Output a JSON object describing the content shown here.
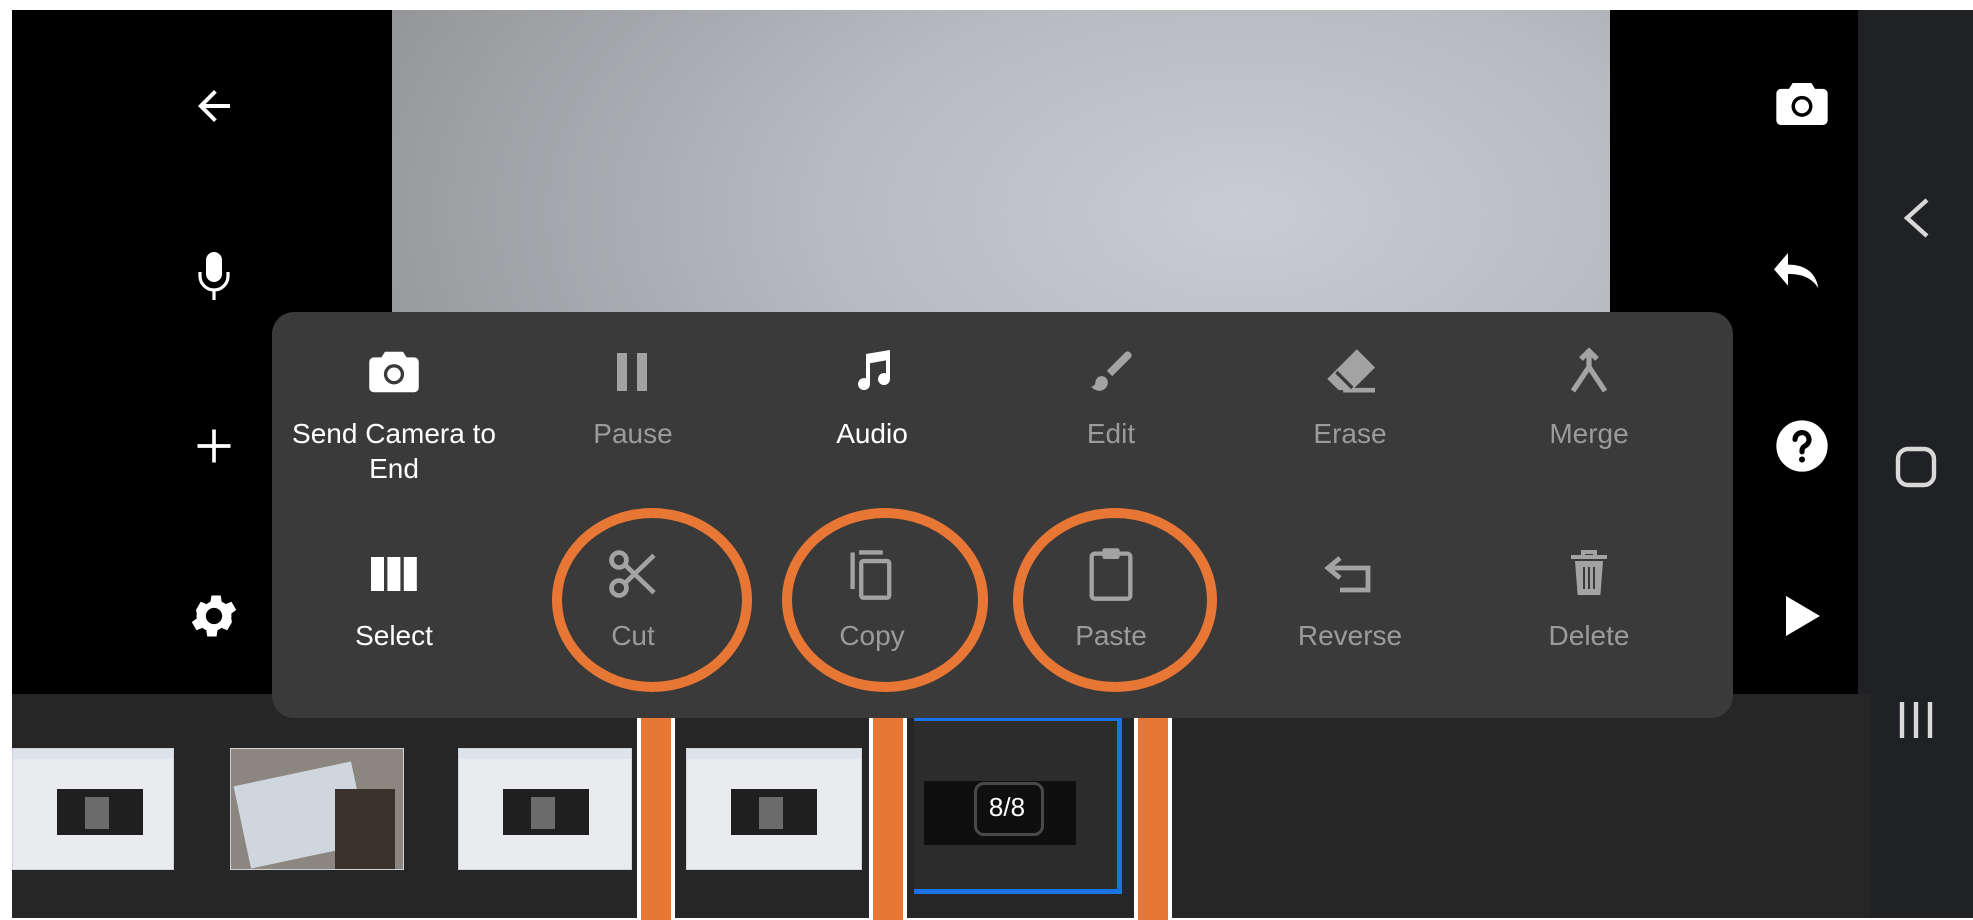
{
  "left_toolbar": {
    "back": "back-arrow-icon",
    "mic": "microphone-icon",
    "add": "plus-icon",
    "settings": "gear-icon"
  },
  "right_toolbar": {
    "camera": "camera-icon",
    "undo": "undo-icon",
    "help": "help-icon",
    "play": "play-icon"
  },
  "context_menu": {
    "row1": [
      {
        "label": "Send Camera to End",
        "icon": "camera-icon",
        "enabled": true
      },
      {
        "label": "Pause",
        "icon": "pause-icon",
        "enabled": false
      },
      {
        "label": "Audio",
        "icon": "music-note-icon",
        "enabled": true
      },
      {
        "label": "Edit",
        "icon": "brush-icon",
        "enabled": false
      },
      {
        "label": "Erase",
        "icon": "eraser-icon",
        "enabled": false
      },
      {
        "label": "Merge",
        "icon": "merge-icon",
        "enabled": false
      }
    ],
    "row2": [
      {
        "label": "Select",
        "icon": "columns-icon",
        "enabled": true
      },
      {
        "label": "Cut",
        "icon": "scissors-icon",
        "enabled": false
      },
      {
        "label": "Copy",
        "icon": "copy-icon",
        "enabled": false
      },
      {
        "label": "Paste",
        "icon": "clipboard-icon",
        "enabled": false
      },
      {
        "label": "Reverse",
        "icon": "reverse-icon",
        "enabled": false
      },
      {
        "label": "Delete",
        "icon": "trash-icon",
        "enabled": false
      }
    ]
  },
  "timeline": {
    "frame_counter": "8/8"
  },
  "colors": {
    "highlight": "#e87634",
    "selection": "#1a73e8",
    "menu_bg": "#3a3a3a"
  }
}
